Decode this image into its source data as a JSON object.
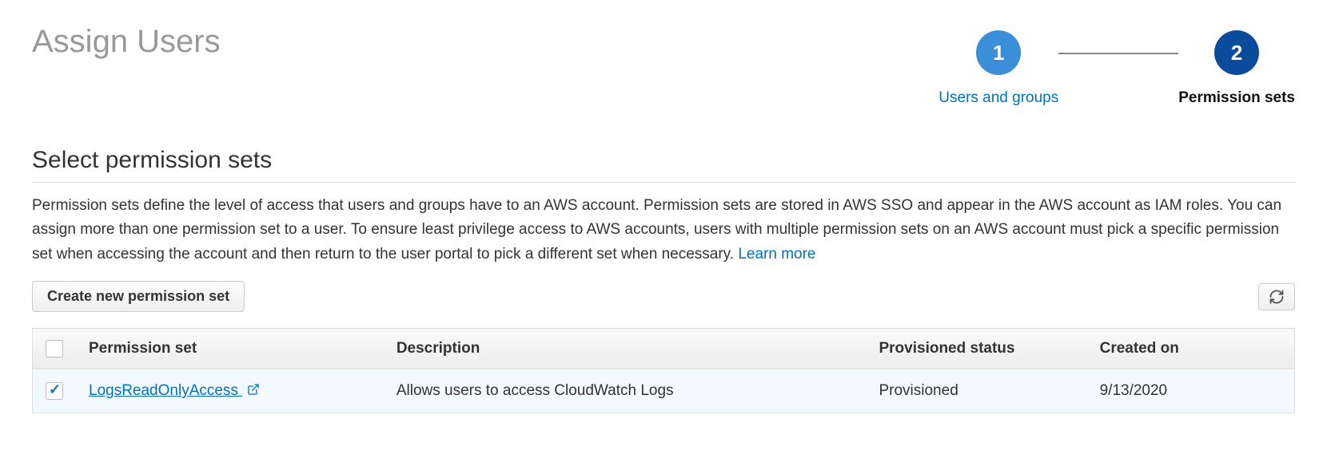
{
  "page_title": "Assign Users",
  "stepper": {
    "steps": [
      {
        "number": "1",
        "label": "Users and groups"
      },
      {
        "number": "2",
        "label": "Permission sets"
      }
    ]
  },
  "section": {
    "title": "Select permission sets",
    "description": "Permission sets define the level of access that users and groups have to an AWS account. Permission sets are stored in AWS SSO and appear in the AWS account as IAM roles. You can assign more than one permission set to a user. To ensure least privilege access to AWS accounts, users with multiple permission sets on an AWS account must pick a specific permission set when accessing the account and then return to the user portal to pick a different set when necessary. ",
    "learn_more": "Learn more"
  },
  "toolbar": {
    "create_btn": "Create new permission set"
  },
  "table": {
    "columns": {
      "name": "Permission set",
      "description": "Description",
      "status": "Provisioned status",
      "created": "Created on"
    },
    "rows": [
      {
        "checked": true,
        "name": "LogsReadOnlyAccess",
        "description": "Allows users to access CloudWatch Logs",
        "status": "Provisioned",
        "created": "9/13/2020"
      }
    ]
  },
  "colors": {
    "link": "#0073bb",
    "step_active": "#0a4b9c",
    "step_done": "#3b8ed8"
  }
}
